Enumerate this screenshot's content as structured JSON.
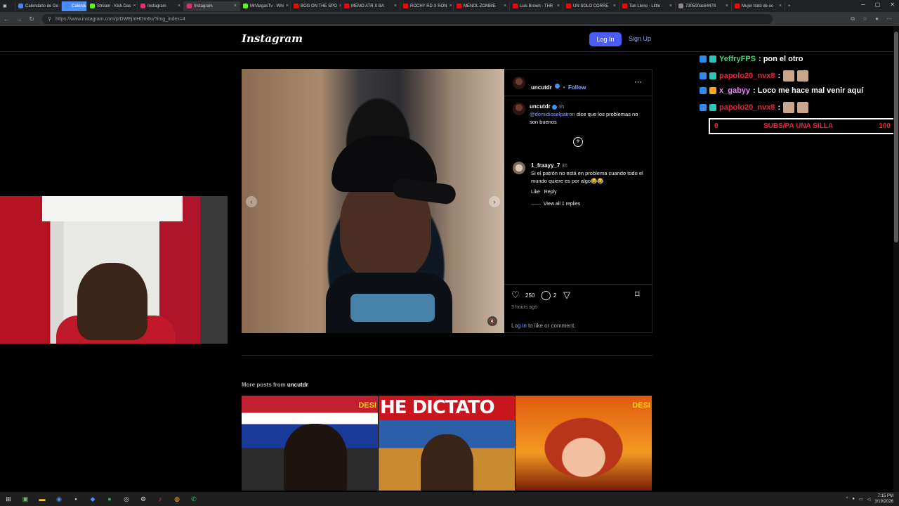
{
  "browser": {
    "tabs": [
      {
        "label": "Calendario de Go",
        "color": "#4285f4",
        "active": false
      },
      {
        "label": "Calendar",
        "color": "#4285f4",
        "active": false,
        "highlight": true
      },
      {
        "label": "Stream - Kick Das",
        "color": "#53fc18",
        "active": false
      },
      {
        "label": "Instagram",
        "color": "#e1306c",
        "active": false
      },
      {
        "label": "Instagram",
        "color": "#e1306c",
        "active": true
      },
      {
        "label": "MrVargasTv - Whi",
        "color": "#53fc18",
        "active": false
      },
      {
        "label": "BOG ON THE SPO",
        "color": "#ff0000",
        "active": false
      },
      {
        "label": "MEMO ATR X BA",
        "color": "#ff0000",
        "active": false
      },
      {
        "label": "ROCHY RD X RON",
        "color": "#ff0000",
        "active": false
      },
      {
        "label": "MENOL ZOMBIE",
        "color": "#ff0000",
        "active": false
      },
      {
        "label": "Luis Brown - THR",
        "color": "#ff0000",
        "active": false
      },
      {
        "label": "UN SOLO CORRE",
        "color": "#ff0000",
        "active": false
      },
      {
        "label": "Tan Lleno - Little",
        "color": "#ff0000",
        "active": false
      },
      {
        "label": "730500ac64478",
        "color": "#888888",
        "active": false
      },
      {
        "label": "Mujer trató de oc",
        "color": "#ff0000",
        "active": false
      }
    ],
    "url": "https://www.instagram.com/p/DWEjntHDm6u/?img_index=4"
  },
  "ig": {
    "logo": "Instagram",
    "login_label": "Log In",
    "signup_label": "Sign Up",
    "post": {
      "author": "uncutdr",
      "follow_label": "Follow",
      "caption_author": "uncutdr",
      "caption_time": "3h",
      "caption_mention": "@domidioselpatron",
      "caption_text": "dice que los problemas no son buenos",
      "comment_author": "1_fraayy_7",
      "comment_time": "3h",
      "comment_text": "Si el patrón no está en problema cuando todo el mundo quiere es por algo😂😂",
      "like_label": "Like",
      "reply_label": "Reply",
      "view_replies": "View all 1 replies",
      "likes": "250",
      "comments": "2",
      "posted": "3 hours ago",
      "login_prompt_link": "Log in",
      "login_prompt_text": "to like or comment."
    },
    "more_posts_label": "More posts from",
    "more_posts_user": "uncutdr",
    "thumbs": [
      {
        "text": "",
        "badge": "DESI"
      },
      {
        "text": "HE DICTATO",
        "badge": ""
      },
      {
        "text": "",
        "badge": "DESI"
      }
    ]
  },
  "chat": [
    {
      "user": "YeffryFPS",
      "message": ": pon el otro",
      "color": "#4fd17a"
    },
    {
      "user": "papolo20_nvx8",
      "message": ":",
      "color": "#e8243c"
    },
    {
      "user": "x_gabyy",
      "message": ": Loco me hace mal venir aquí",
      "color": "#e887f2"
    },
    {
      "user": "papolo20_nvx8",
      "message": ":",
      "color": "#e8243c"
    }
  ],
  "goal": {
    "current": "0",
    "label": "SUBS/PA UNA SILLA",
    "target": "100",
    "progress": 0
  },
  "taskbar": {
    "time": "7:15 PM",
    "date": "3/19/2026"
  }
}
